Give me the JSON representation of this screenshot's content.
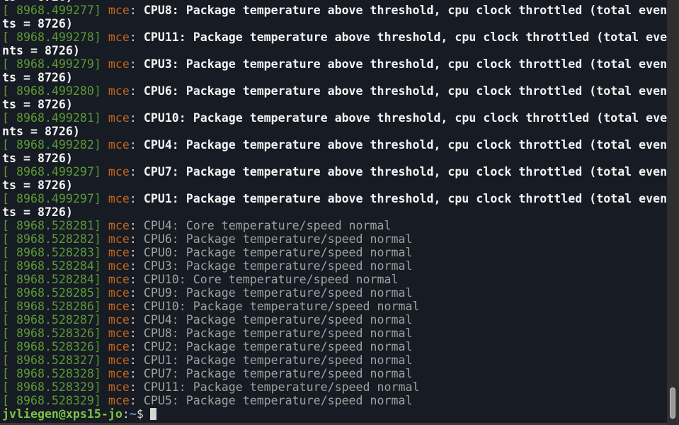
{
  "terminal": {
    "lines": [
      {
        "kind": "wrap",
        "text": "ts = 8726)"
      },
      {
        "kind": "log",
        "ts": "[ 8968.499277]",
        "src": "mce",
        "msg": "CPU8: Package temperature above threshold, cpu clock throttled (total even",
        "bold": true
      },
      {
        "kind": "wrap",
        "text": "ts = 8726)"
      },
      {
        "kind": "log",
        "ts": "[ 8968.499278]",
        "src": "mce",
        "msg": "CPU11: Package temperature above threshold, cpu clock throttled (total eve",
        "bold": true
      },
      {
        "kind": "wrap",
        "text": "nts = 8726)"
      },
      {
        "kind": "log",
        "ts": "[ 8968.499279]",
        "src": "mce",
        "msg": "CPU3: Package temperature above threshold, cpu clock throttled (total even",
        "bold": true
      },
      {
        "kind": "wrap",
        "text": "ts = 8726)"
      },
      {
        "kind": "log",
        "ts": "[ 8968.499280]",
        "src": "mce",
        "msg": "CPU6: Package temperature above threshold, cpu clock throttled (total even",
        "bold": true
      },
      {
        "kind": "wrap",
        "text": "ts = 8726)"
      },
      {
        "kind": "log",
        "ts": "[ 8968.499281]",
        "src": "mce",
        "msg": "CPU10: Package temperature above threshold, cpu clock throttled (total eve",
        "bold": true
      },
      {
        "kind": "wrap",
        "text": "nts = 8726)"
      },
      {
        "kind": "log",
        "ts": "[ 8968.499282]",
        "src": "mce",
        "msg": "CPU4: Package temperature above threshold, cpu clock throttled (total even",
        "bold": true
      },
      {
        "kind": "wrap",
        "text": "ts = 8726)"
      },
      {
        "kind": "log",
        "ts": "[ 8968.499297]",
        "src": "mce",
        "msg": "CPU7: Package temperature above threshold, cpu clock throttled (total even",
        "bold": true
      },
      {
        "kind": "wrap",
        "text": "ts = 8726)"
      },
      {
        "kind": "log",
        "ts": "[ 8968.499297]",
        "src": "mce",
        "msg": "CPU1: Package temperature above threshold, cpu clock throttled (total even",
        "bold": true
      },
      {
        "kind": "wrap",
        "text": "ts = 8726)"
      },
      {
        "kind": "log",
        "ts": "[ 8968.528281]",
        "src": "mce",
        "msg": "CPU4: Core temperature/speed normal",
        "bold": false
      },
      {
        "kind": "log",
        "ts": "[ 8968.528282]",
        "src": "mce",
        "msg": "CPU6: Package temperature/speed normal",
        "bold": false
      },
      {
        "kind": "log",
        "ts": "[ 8968.528283]",
        "src": "mce",
        "msg": "CPU0: Package temperature/speed normal",
        "bold": false
      },
      {
        "kind": "log",
        "ts": "[ 8968.528284]",
        "src": "mce",
        "msg": "CPU3: Package temperature/speed normal",
        "bold": false
      },
      {
        "kind": "log",
        "ts": "[ 8968.528284]",
        "src": "mce",
        "msg": "CPU10: Core temperature/speed normal",
        "bold": false
      },
      {
        "kind": "log",
        "ts": "[ 8968.528285]",
        "src": "mce",
        "msg": "CPU9: Package temperature/speed normal",
        "bold": false
      },
      {
        "kind": "log",
        "ts": "[ 8968.528286]",
        "src": "mce",
        "msg": "CPU10: Package temperature/speed normal",
        "bold": false
      },
      {
        "kind": "log",
        "ts": "[ 8968.528287]",
        "src": "mce",
        "msg": "CPU4: Package temperature/speed normal",
        "bold": false
      },
      {
        "kind": "log",
        "ts": "[ 8968.528326]",
        "src": "mce",
        "msg": "CPU8: Package temperature/speed normal",
        "bold": false
      },
      {
        "kind": "log",
        "ts": "[ 8968.528326]",
        "src": "mce",
        "msg": "CPU2: Package temperature/speed normal",
        "bold": false
      },
      {
        "kind": "log",
        "ts": "[ 8968.528327]",
        "src": "mce",
        "msg": "CPU1: Package temperature/speed normal",
        "bold": false
      },
      {
        "kind": "log",
        "ts": "[ 8968.528328]",
        "src": "mce",
        "msg": "CPU7: Package temperature/speed normal",
        "bold": false
      },
      {
        "kind": "log",
        "ts": "[ 8968.528329]",
        "src": "mce",
        "msg": "CPU11: Package temperature/speed normal",
        "bold": false
      },
      {
        "kind": "log",
        "ts": "[ 8968.528329]",
        "src": "mce",
        "msg": "CPU5: Package temperature/speed normal",
        "bold": false
      }
    ],
    "prompt": {
      "user_host": "jvliegen@xps15-jo",
      "colon": ":",
      "path": "~",
      "dollar": "$"
    },
    "colors": {
      "background": "#171b24",
      "timestamp": "#5a9a33",
      "source": "#c4661a",
      "bold_text": "#f4f4f4",
      "normal_text": "#9da39d",
      "prompt_user": "#7bc443",
      "prompt_path": "#5a9be8"
    }
  }
}
